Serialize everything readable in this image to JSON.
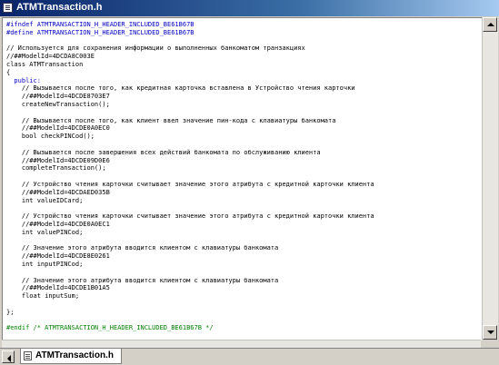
{
  "window": {
    "title": "ATMTransaction.h"
  },
  "editor": {
    "lines": [
      {
        "text": "#ifndef ATMTRANSACTION_H_HEADER_INCLUDED_BE61B67B",
        "cls": "pp"
      },
      {
        "text": "#define ATMTRANSACTION_H_HEADER_INCLUDED_BE61B67B",
        "cls": "pp"
      },
      {
        "text": "",
        "cls": ""
      },
      {
        "text": "// Используется для сохранения информации о выполненных банкоматом транзакциях",
        "cls": ""
      },
      {
        "text": "//##ModelId=4DCDA8C003E",
        "cls": ""
      },
      {
        "text": "class ATMTransaction",
        "cls": ""
      },
      {
        "text": "{",
        "cls": ""
      },
      {
        "text": "  public:",
        "cls": "kw"
      },
      {
        "text": "    // Вызывается после того, как кредитная карточка вставлена в Устройство чтения карточки",
        "cls": ""
      },
      {
        "text": "    //##ModelId=4DCDE8703E7",
        "cls": ""
      },
      {
        "text": "    createNewTransaction();",
        "cls": ""
      },
      {
        "text": "",
        "cls": ""
      },
      {
        "text": "    // Вызывается после того, как клиент ввел значение пин-кода с клавиатуры банкомата",
        "cls": ""
      },
      {
        "text": "    //##ModelId=4DCDE0A0EC0",
        "cls": ""
      },
      {
        "text": "    bool checkPINCod();",
        "cls": ""
      },
      {
        "text": "",
        "cls": ""
      },
      {
        "text": "    // Вызывается после завершения всех действий банкомата по обслуживанию клиента",
        "cls": ""
      },
      {
        "text": "    //##ModelId=4DCDE09D0E6",
        "cls": ""
      },
      {
        "text": "    completeTransaction();",
        "cls": ""
      },
      {
        "text": "",
        "cls": ""
      },
      {
        "text": "    // Устройство чтения карточки считывает значение этого атрибута с кредитной карточки клиента",
        "cls": ""
      },
      {
        "text": "    //##ModelId=4DCDAED035B",
        "cls": ""
      },
      {
        "text": "    int valueIDCard;",
        "cls": ""
      },
      {
        "text": "",
        "cls": ""
      },
      {
        "text": "    // Устройство чтения карточки считывает значение этого атрибута с кредитной карточки клиента",
        "cls": ""
      },
      {
        "text": "    //##ModelId=4DCDE0A0EC1",
        "cls": ""
      },
      {
        "text": "    int valuePINCod;",
        "cls": ""
      },
      {
        "text": "",
        "cls": ""
      },
      {
        "text": "    // Значение этого атрибута вводится клиентом с клавиатуры банкомата",
        "cls": ""
      },
      {
        "text": "    //##ModelId=4DCDE8E0261",
        "cls": ""
      },
      {
        "text": "    int inputPINCod;",
        "cls": ""
      },
      {
        "text": "",
        "cls": ""
      },
      {
        "text": "    // Значение этого атрибута вводится клиентом с клавиатуры банкомата",
        "cls": ""
      },
      {
        "text": "    //##ModelId=4DCDE1B01A5",
        "cls": ""
      },
      {
        "text": "    float inputSum;",
        "cls": ""
      },
      {
        "text": "",
        "cls": ""
      },
      {
        "text": "};",
        "cls": ""
      },
      {
        "text": "",
        "cls": ""
      },
      {
        "text": "#endif /* ATMTRANSACTION_H_HEADER_INCLUDED_BE61B67B */",
        "cls": "cm"
      }
    ]
  },
  "tabs": [
    {
      "label": "ATMTransaction.h"
    }
  ]
}
